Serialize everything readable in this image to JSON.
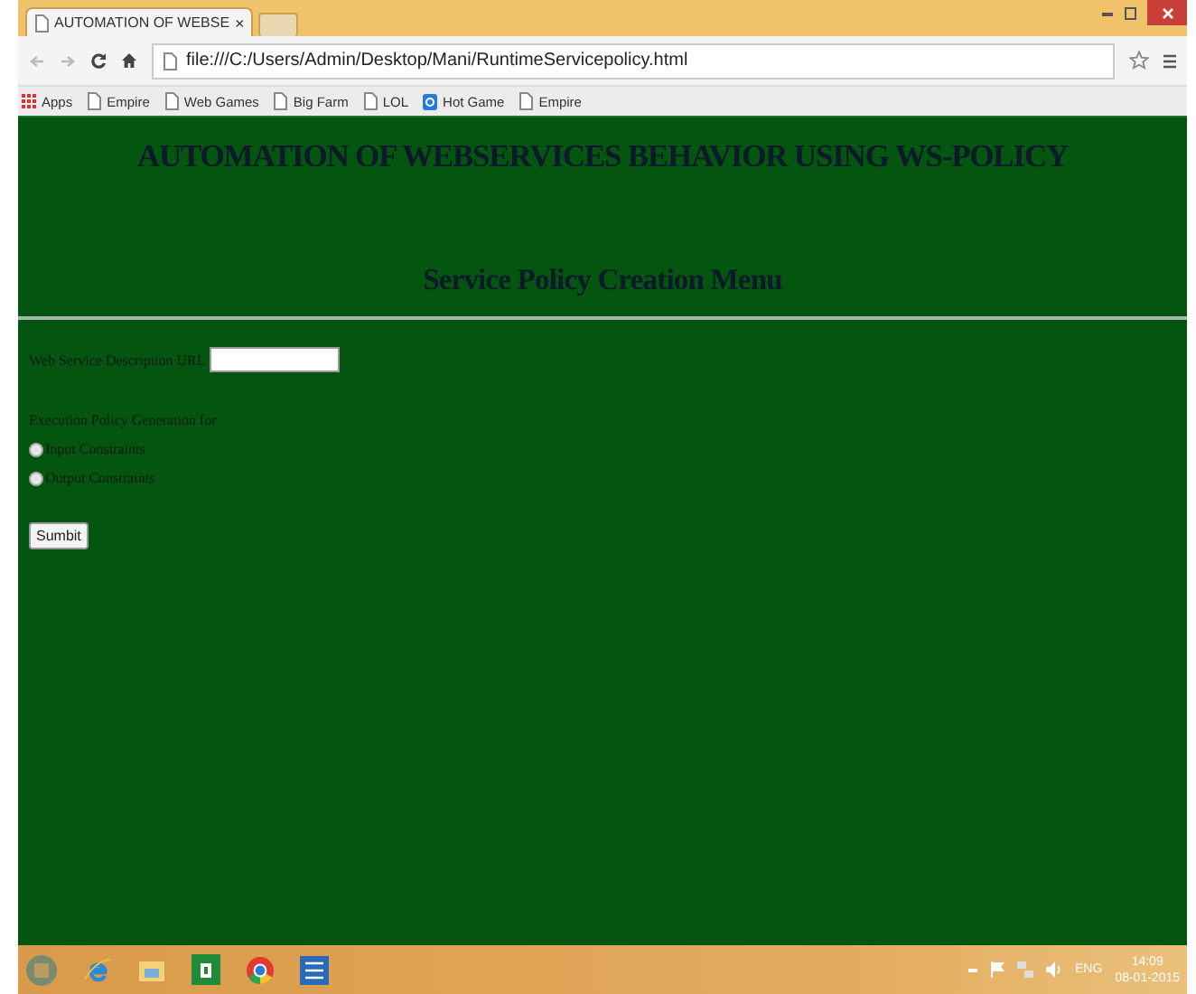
{
  "browser": {
    "tab": {
      "title": "AUTOMATION OF WEBSE",
      "close": "×"
    },
    "address": "file:///C:/Users/Admin/Desktop/Mani/RuntimeServicepolicy.html",
    "bookmarks": [
      {
        "label": "Apps",
        "kind": "apps"
      },
      {
        "label": "Empire",
        "kind": "page"
      },
      {
        "label": "Web Games",
        "kind": "page"
      },
      {
        "label": "Big Farm",
        "kind": "page"
      },
      {
        "label": "LOL",
        "kind": "page"
      },
      {
        "label": "Hot Game",
        "kind": "site"
      },
      {
        "label": "Empire",
        "kind": "page"
      }
    ]
  },
  "page": {
    "title": "AUTOMATION OF WEBSERVICES BEHAVIOR USING WS-POLICY",
    "subtitle": "Service Policy Creation Menu",
    "url_label": "Web Service Description URL",
    "section_label": "Execution Policy Generation for",
    "options": [
      {
        "label": "Input Constraints",
        "selected": false
      },
      {
        "label": "Output Constraints",
        "selected": false
      }
    ],
    "submit": "Sumbit"
  },
  "taskbar": {
    "language": "ENG",
    "time": "14:09",
    "date": "08-01-2015"
  }
}
